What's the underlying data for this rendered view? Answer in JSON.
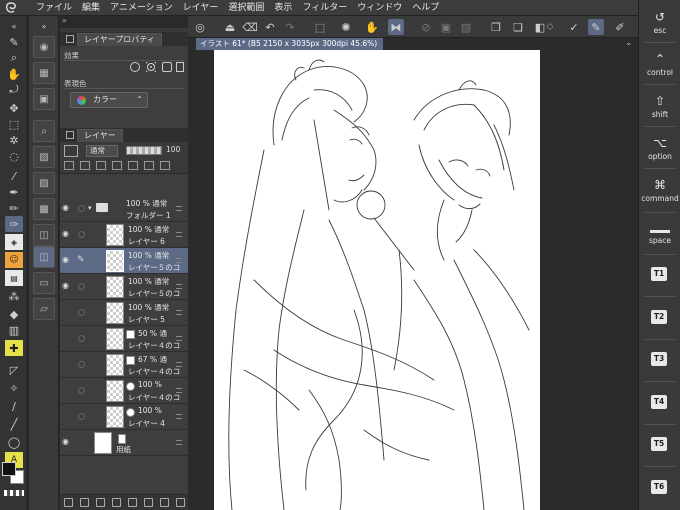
{
  "menu": {
    "items": [
      "ファイル",
      "編集",
      "アニメーション",
      "レイヤー",
      "選択範囲",
      "表示",
      "フィルター",
      "ウィンドウ",
      "ヘルプ"
    ]
  },
  "panels": {
    "property_tab": "レイヤープロパティ",
    "effect_label": "効果",
    "expression_color_label": "表現色",
    "expression_color_value": "カラー",
    "layer_tab": "レイヤー",
    "blend_mode": "通常",
    "opacity": "100"
  },
  "layers": [
    {
      "mode": "100 % 通常",
      "name": "フォルダー 1",
      "kind": "folder"
    },
    {
      "mode": "100 % 通常",
      "name": "レイヤー 6",
      "kind": "raster"
    },
    {
      "mode": "100 % 通常",
      "name": "レイヤー５のコ",
      "kind": "raster",
      "selected": true
    },
    {
      "mode": "100 % 通常",
      "name": "レイヤー５のコ",
      "kind": "raster"
    },
    {
      "mode": "100 % 通常",
      "name": "レイヤー 5",
      "kind": "raster"
    },
    {
      "mode": "50 % 通",
      "name": "レイヤー４のコ",
      "kind": "masked"
    },
    {
      "mode": "67 % 通",
      "name": "レイヤー４のコ",
      "kind": "masked"
    },
    {
      "mode": "100 %",
      "name": "レイヤー４のコ",
      "kind": "masked2"
    },
    {
      "mode": "100 %",
      "name": "レイヤー 4",
      "kind": "masked2"
    },
    {
      "mode": "",
      "name": "用紙",
      "kind": "paper"
    }
  ],
  "canvas": {
    "tab_title": "イラスト 61* (B5 2150 x 3035px 300dpi 45.6%)"
  },
  "shortcuts": {
    "esc": "esc",
    "control": "control",
    "shift": "shift",
    "option": "option",
    "command": "command",
    "space": "space",
    "t_keys": [
      "T1",
      "T2",
      "T3",
      "T4",
      "T5",
      "T6"
    ]
  },
  "colors": {
    "selection": "#5c6a86",
    "panel_bg": "#3a3a3a",
    "canvas_bg": "#2b2b2b"
  }
}
